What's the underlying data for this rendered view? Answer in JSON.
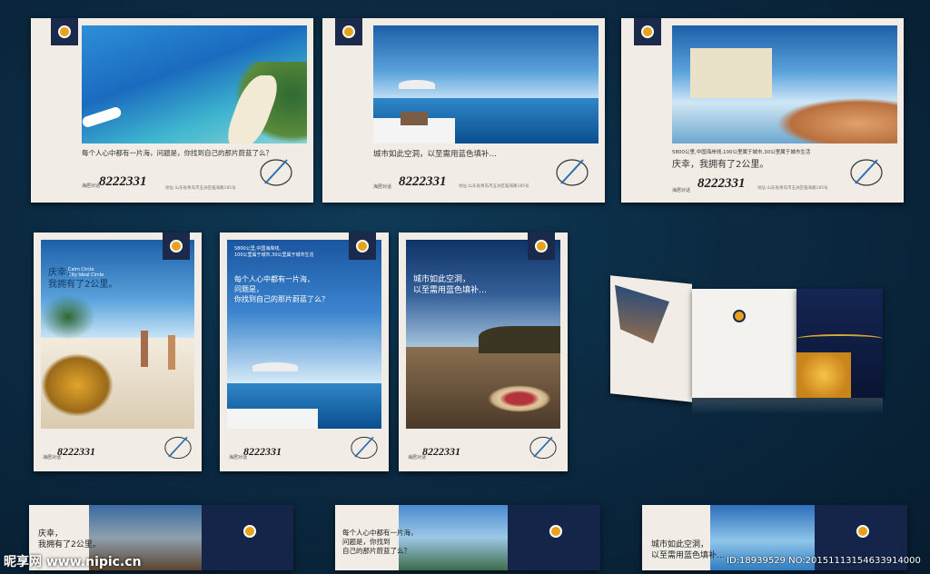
{
  "ads": {
    "a1": {
      "tag": "每个人心中都有一片海，问题是，你找到自己的那片蔚蓝了么？",
      "phone": "8222331",
      "phone_label": "海居对话",
      "addr": "地址:山东省青岛市五洲区临海路185号"
    },
    "a2": {
      "tag": "城市如此空洞，以至需用蓝色填补…",
      "phone": "8222331",
      "phone_label": "海居对话",
      "addr": "地址:山东省青岛市五洲区临海路185号"
    },
    "a3": {
      "tag_small": "5800公里,中国海岸线,100公里属于城市,30公里属于城市生活",
      "tag": "庆幸，我拥有了2公里。",
      "phone": "8222331",
      "phone_label": "海居对话",
      "addr": "地址:山东省青岛市五洲区临海路185号"
    },
    "b1": {
      "tag": "庆幸，\n我拥有了2公里。",
      "sub": "Calm Circle\nCity Ideal Circle",
      "phone": "8222331",
      "phone_label": "海居对话"
    },
    "b2": {
      "tag_small": "5800公里,中国海岸线,\n100公里属于城市,30公里属于城市生活",
      "tag": "每个人心中都有一片海，\n问题是，\n你找到自己的那片蔚蓝了么？",
      "phone": "8222331",
      "phone_label": "海居对话"
    },
    "b3": {
      "tag": "城市如此空洞，\n以至需用蓝色填补…",
      "phone": "8222331",
      "phone_label": "海居对话"
    },
    "c1": {
      "tag": "庆幸，\n我拥有了2公里。"
    },
    "c2": {
      "tag": "每个人心中都有一片海，\n问题是，你找到\n自己的那片蔚蓝了么？"
    },
    "c3": {
      "tag": "城市如此空洞，\n以至需用蓝色填补…"
    }
  },
  "watermark": {
    "site": "昵享网 www.nipic.cn",
    "id": "ID:18939529 NO:20151113154633914000"
  },
  "colors": {
    "bg": "#0b2a42",
    "paper": "#f1ede6",
    "logo_bg": "#1b2a4a",
    "accent": "#e8a21c"
  }
}
